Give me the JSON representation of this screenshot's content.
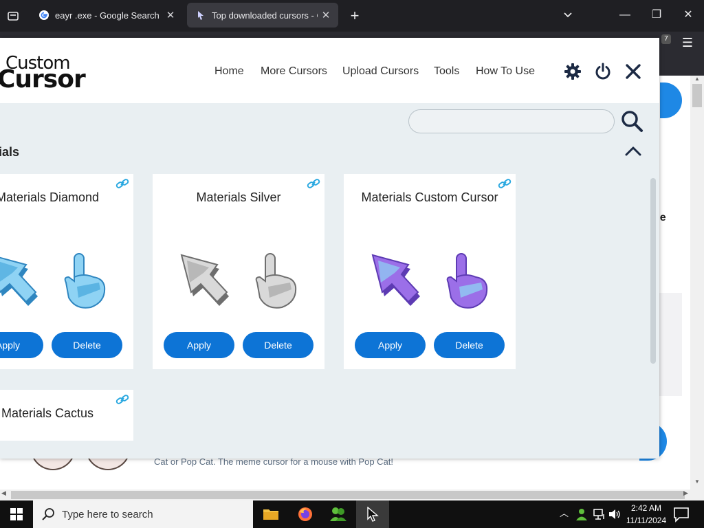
{
  "browser": {
    "tabs": [
      {
        "title": "eayr .exe - Google Search"
      },
      {
        "title": "Top downloaded cursors - Custom Cursor"
      }
    ],
    "extension_badge": "7"
  },
  "popup": {
    "logo": {
      "top": "Custom",
      "bottom": "Cursor"
    },
    "nav": {
      "home": "Home",
      "more": "More Cursors",
      "upload": "Upload Cursors",
      "tools": "Tools",
      "howto": "How To Use"
    },
    "search": {
      "placeholder": "",
      "value": ""
    },
    "section_title": "ials",
    "cards": [
      {
        "title": "Materials Diamond",
        "apply": "Apply",
        "delete": "Delete",
        "colors": {
          "main": "#8fd3f4",
          "shade": "#4aa9dd",
          "edge": "#2f86c0"
        }
      },
      {
        "title": "Materials Silver",
        "apply": "Apply",
        "delete": "Delete",
        "colors": {
          "main": "#d9d9d9",
          "shade": "#a9a9a9",
          "edge": "#6e6e6e"
        }
      },
      {
        "title": "Materials Custom Cursor",
        "apply": "Apply",
        "delete": "Delete",
        "colors": {
          "main": "#9b6fe8",
          "shade": "#8fd3f4",
          "edge": "#5d3bb3"
        }
      },
      {
        "title": "Materials Cactus"
      }
    ]
  },
  "page": {
    "right_text": "ne\ne",
    "caption": "Cat or Pop Cat. The meme cursor for a mouse with Pop Cat!"
  },
  "taskbar": {
    "search_placeholder": "Type here to search",
    "time": "2:42 AM",
    "date": "11/11/2024"
  },
  "colors": {
    "accent": "#0d74d6",
    "popup_bg": "#e9eff2",
    "tabbar": "#1f1f23"
  }
}
